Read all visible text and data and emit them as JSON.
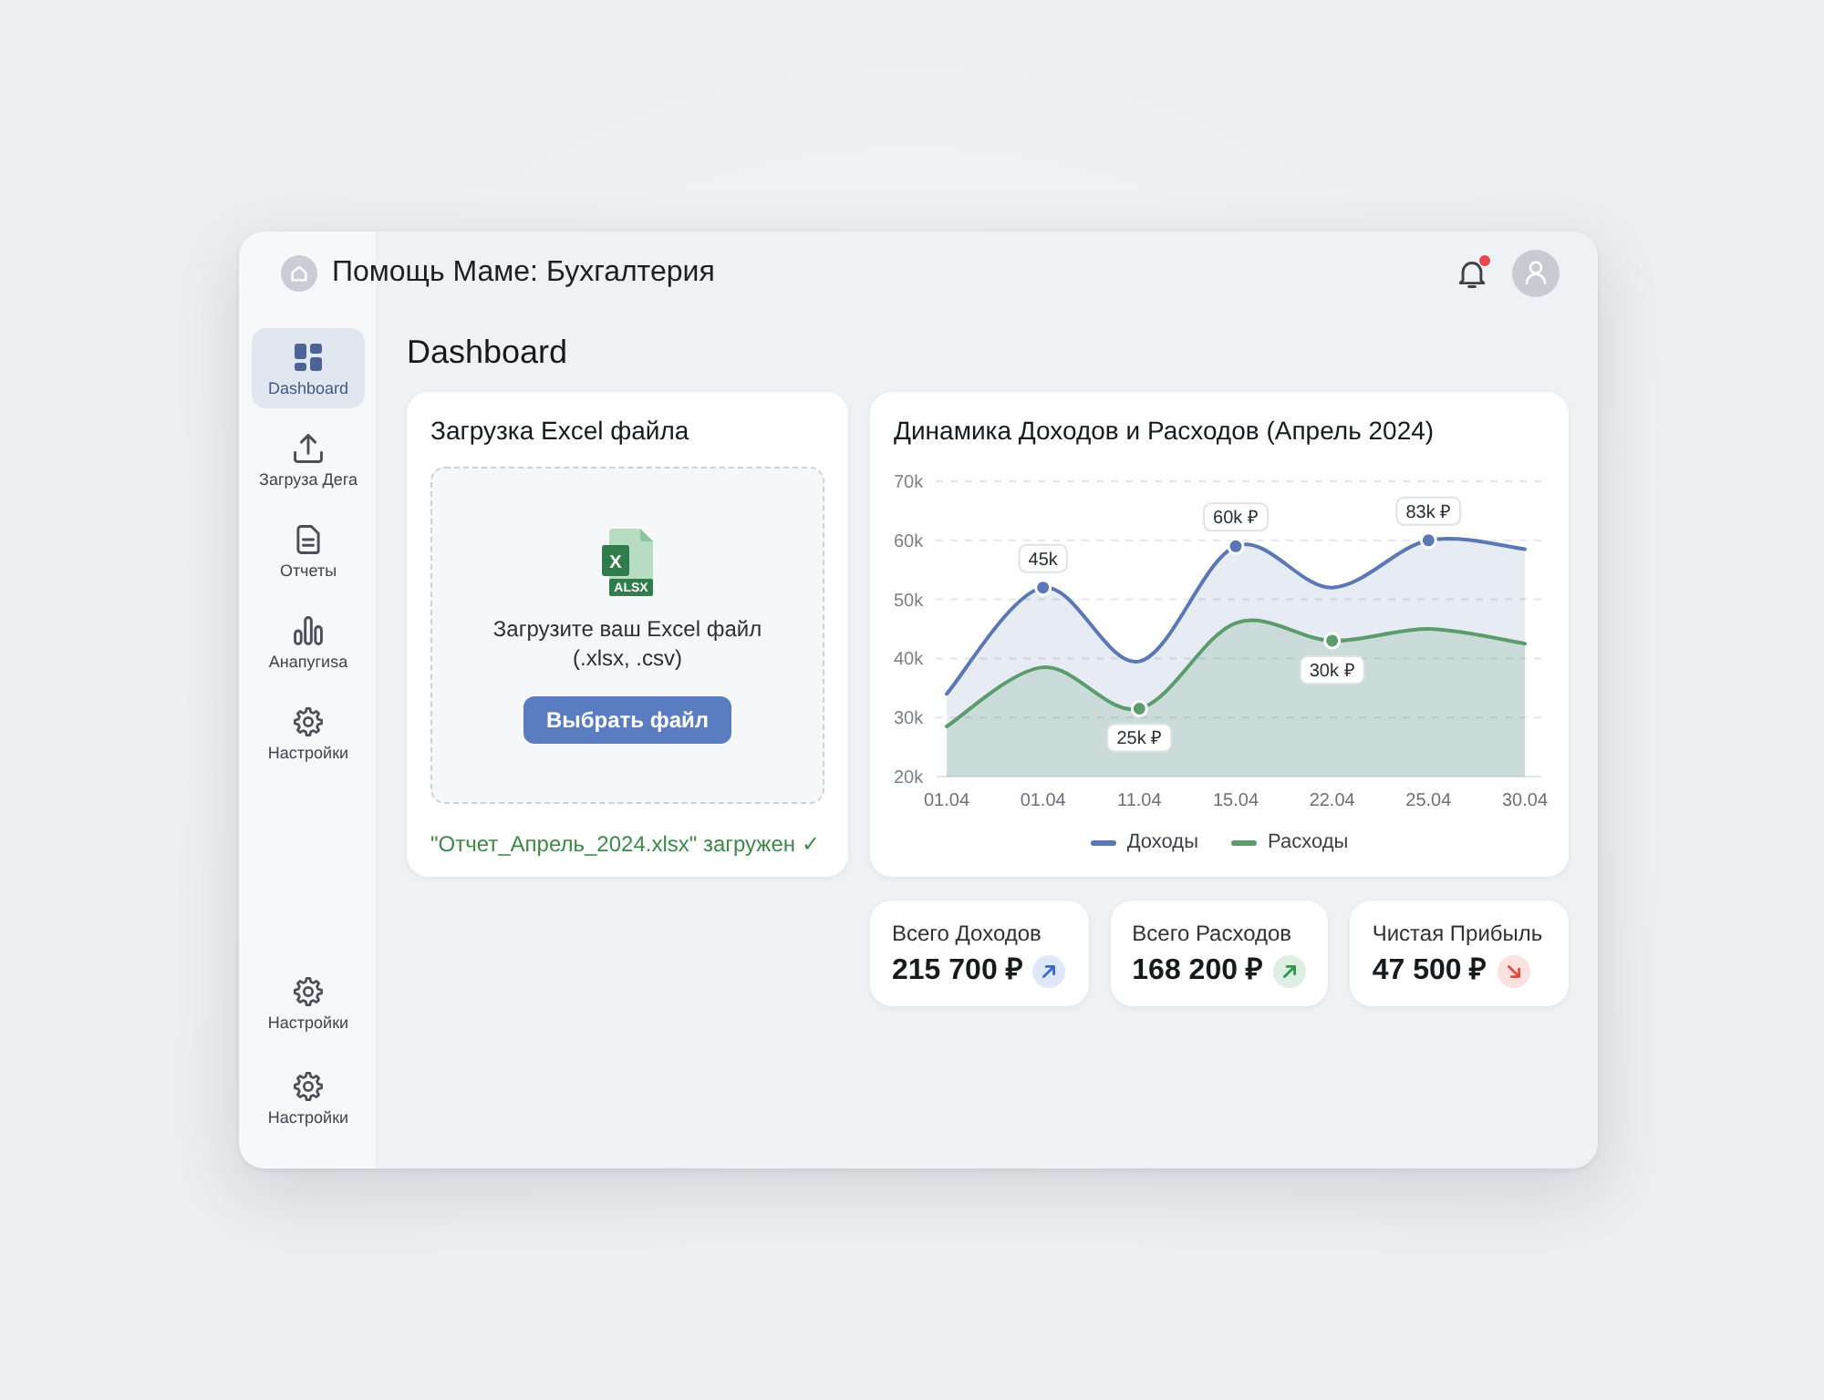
{
  "header": {
    "title": "Помощь Маме: Бухгалтерия",
    "notification_unread": true
  },
  "sidebar": {
    "items": [
      {
        "kind": "dashboard",
        "label": "Dashboard",
        "selected": true
      },
      {
        "kind": "upload",
        "label": "Загруза Дега",
        "selected": false
      },
      {
        "kind": "reports",
        "label": "Отчеты",
        "selected": false
      },
      {
        "kind": "analytics",
        "label": "Анапугиsa",
        "selected": false
      },
      {
        "kind": "settings",
        "label": "Настройки",
        "selected": false
      }
    ],
    "bottom_items": [
      {
        "kind": "settings",
        "label": "Настройки",
        "selected": false
      },
      {
        "kind": "settings",
        "label": "Настройки",
        "selected": false
      }
    ]
  },
  "page": {
    "title": "Dashboard"
  },
  "upload_card": {
    "title": "Загрузка Excel файла",
    "file_icon_letter": "X",
    "file_icon_tag": "ALSX",
    "hint": "Загрузите ваш Excel файл (.xlsx, .csv)",
    "button": "Выбрать файл",
    "status": "\"Отчет_Апрель_2024.xlsx\" загружен ✓"
  },
  "chart_card": {
    "title": "Динамика Доходов и Расходов (Апрель 2024)",
    "chart_data": {
      "type": "area",
      "grid": true,
      "categories": [
        "01.04",
        "01.04",
        "11.04",
        "15.04",
        "22.04",
        "25.04",
        "30.04"
      ],
      "ylim": [
        20,
        70
      ],
      "yticks": [
        {
          "value": 20,
          "label": "20k"
        },
        {
          "value": 30,
          "label": "30k"
        },
        {
          "value": 40,
          "label": "40k"
        },
        {
          "value": 50,
          "label": "50k"
        },
        {
          "value": 60,
          "label": "60k"
        },
        {
          "value": 70,
          "label": "70k"
        }
      ],
      "series": [
        {
          "name": "Доходы",
          "color": "#5a78b6",
          "values": [
            34,
            52,
            39.5,
            59,
            52,
            60,
            58.5
          ]
        },
        {
          "name": "Расходы",
          "color": "#5b9c6c",
          "values": [
            28.5,
            38.5,
            31.5,
            46,
            43,
            45,
            42.5
          ]
        }
      ],
      "annotations": [
        "45k",
        {
          "x": "15.04",
          "y": 59,
          "text": "60k ₽"
        },
        {
          "x": "25.04",
          "y": 60,
          "text": "83k ₽"
        },
        {
          "x": "11.04",
          "y": 31.5,
          "text": "25k ₽"
        },
        {
          "x": "22.04",
          "y": 43,
          "text": "30k ₽"
        }
      ]
    }
  },
  "stats": [
    {
      "label": "Всего Доходов",
      "value": "215 700 ₽",
      "rising": true,
      "color": "#dfe7f8"
    },
    {
      "label": "Всего Расходов",
      "value": "168 200 ₽",
      "rising": true,
      "color": "#dcefe2"
    },
    {
      "label": "Чистая Прибыль",
      "value": "47 500 ₽",
      "rising": false,
      "color": "#fbe2e0"
    }
  ]
}
